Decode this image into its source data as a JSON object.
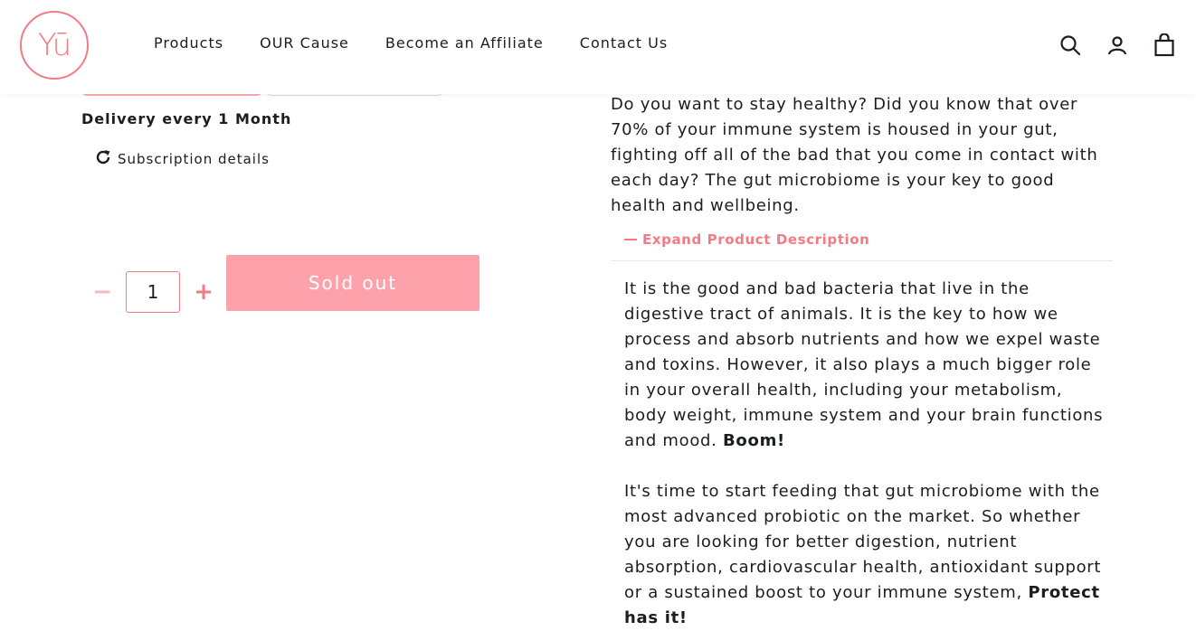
{
  "brand": {
    "logo_text": "Yū",
    "accent_color": "#f27b86",
    "soldout_color": "#fda2ab"
  },
  "nav": {
    "items": [
      {
        "label": "Products"
      },
      {
        "label": "OUR Cause"
      },
      {
        "label": "Become an Affiliate"
      },
      {
        "label": "Contact Us"
      }
    ]
  },
  "header_icons": [
    "search-icon",
    "account-icon",
    "cart-icon"
  ],
  "purchase": {
    "delivery_text": "Delivery every 1 Month",
    "subscription_details_label": "Subscription details",
    "quantity_value": "1",
    "minus_symbol": "−",
    "plus_symbol": "+",
    "soldout_label": "Sold out"
  },
  "description": {
    "intro": "Do you want to stay healthy? Did you know that over 70% of your immune system is housed in your gut, fighting off all of the bad that you come in contact with each day? The gut microbiome is your key to good health and wellbeing.",
    "expand_label": "Expand Product Description",
    "para1": "It is the good and bad bacteria that live in the digestive tract of animals. It is the key to how we process and absorb nutrients and how we expel waste and toxins. However, it also plays a much bigger role in your overall health, including your metabolism, body weight, immune system and your brain functions and mood.",
    "para1_bold": "Boom!",
    "para2": "It's time to start feeding that gut microbiome with the most advanced probiotic on the market. So whether you are looking for better digestion, nutrient absorption, cardiovascular health, antioxidant support or a sustained boost to your immune system,",
    "para2_bold": "Protect has it!"
  }
}
